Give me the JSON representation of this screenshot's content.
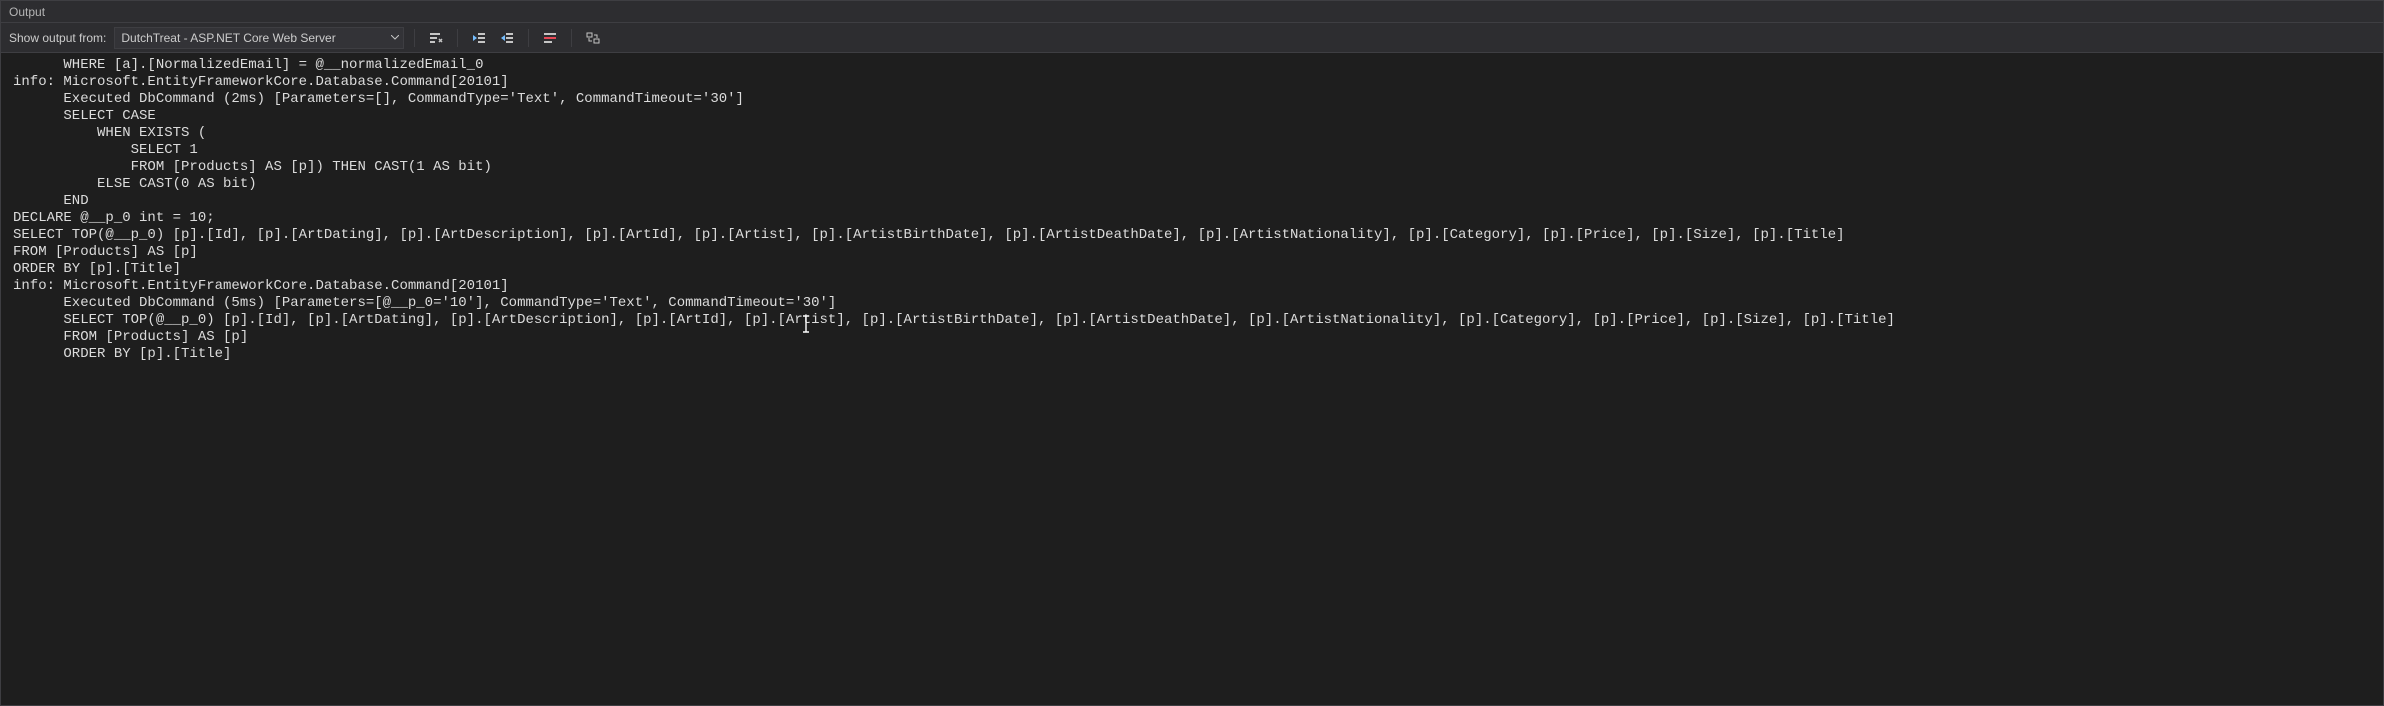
{
  "panel": {
    "title": "Output"
  },
  "toolbar": {
    "label": "Show output from:",
    "sourceSelected": "DutchTreat - ASP.NET Core Web Server",
    "icons": {
      "clear": "clear-all-icon",
      "indentLeft": "outdent-icon",
      "indentRight": "indent-icon",
      "wordWrap": "word-wrap-icon",
      "copy": "copy-icon"
    }
  },
  "log": "      WHERE [a].[NormalizedEmail] = @__normalizedEmail_0\ninfo: Microsoft.EntityFrameworkCore.Database.Command[20101]\n      Executed DbCommand (2ms) [Parameters=[], CommandType='Text', CommandTimeout='30']\n      SELECT CASE\n          WHEN EXISTS (\n              SELECT 1\n              FROM [Products] AS [p]) THEN CAST(1 AS bit)\n          ELSE CAST(0 AS bit)\n      END\nDECLARE @__p_0 int = 10;\nSELECT TOP(@__p_0) [p].[Id], [p].[ArtDating], [p].[ArtDescription], [p].[ArtId], [p].[Artist], [p].[ArtistBirthDate], [p].[ArtistDeathDate], [p].[ArtistNationality], [p].[Category], [p].[Price], [p].[Size], [p].[Title]\nFROM [Products] AS [p]\nORDER BY [p].[Title]\ninfo: Microsoft.EntityFrameworkCore.Database.Command[20101]\n      Executed DbCommand (5ms) [Parameters=[@__p_0='10'], CommandType='Text', CommandTimeout='30']\n      SELECT TOP(@__p_0) [p].[Id], [p].[ArtDating], [p].[ArtDescription], [p].[ArtId], [p].[Artist], [p].[ArtistBirthDate], [p].[ArtistDeathDate], [p].[ArtistNationality], [p].[Category], [p].[Price], [p].[Size], [p].[Title]\n      FROM [Products] AS [p]\n      ORDER BY [p].[Title]"
}
